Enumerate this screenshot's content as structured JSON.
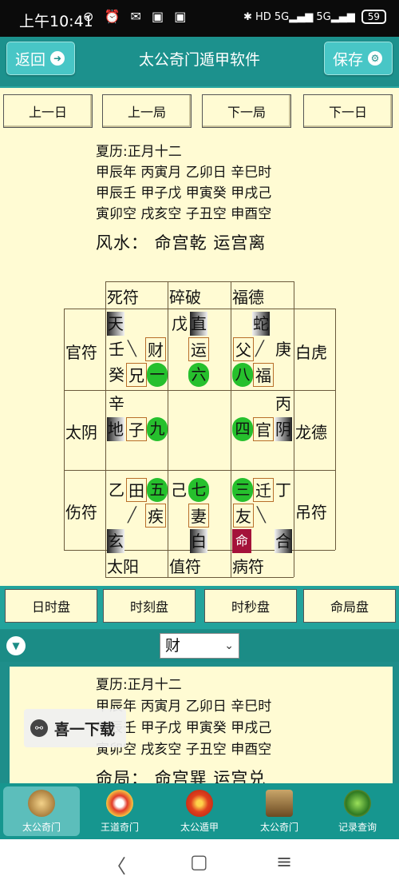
{
  "status": {
    "time": "上午10:41",
    "left_icons": "⊘ ⏰ ✉ ▣ ▣",
    "right_icons": "✱ HD 5G▂▄▆ 5G▂▄▆",
    "battery": "59"
  },
  "header": {
    "back": "返回",
    "title": "太公奇门遁甲软件",
    "save": "保存"
  },
  "nav": {
    "prev_day": "上一日",
    "prev_ju": "上一局",
    "next_ju": "下一局",
    "next_day": "下一日"
  },
  "info": {
    "line1": "夏历:正月十二",
    "line2": "甲辰年 丙寅月 乙卯日 辛巳时",
    "line3": "甲辰壬 甲子戊 甲寅癸 甲戌己",
    "line4": "寅卯空 戌亥空 子丑空 申酉空",
    "fengshui": "风水： 命宫乾 运宫离"
  },
  "chart": {
    "top": [
      "死符",
      "碎破",
      "福德"
    ],
    "bottom": [
      "太阳",
      "值符",
      "病符"
    ],
    "left": [
      "官符",
      "太阴",
      "伤符"
    ],
    "right": [
      "白虎",
      "龙德",
      "吊符"
    ],
    "c_nw": {
      "a": "天",
      "b": "壬",
      "c": "癸",
      "d": "兄",
      "e": "财",
      "num": "一"
    },
    "c_n": {
      "a": "戊",
      "b": "直",
      "c": "运",
      "num": "六"
    },
    "c_ne": {
      "a": "蛇",
      "b": "父",
      "c": "庚",
      "d": "福",
      "num": "八"
    },
    "c_w": {
      "a": "辛",
      "b": "地",
      "c": "子",
      "num": "九"
    },
    "c_e": {
      "a": "丙",
      "b": "官",
      "c": "阴",
      "num": "四"
    },
    "c_sw": {
      "a": "乙",
      "b": "田",
      "c": "疾",
      "d": "玄",
      "num": "五"
    },
    "c_s": {
      "a": "己",
      "b": "妻",
      "c": "白",
      "num": "七"
    },
    "c_se": {
      "a": "迁",
      "b": "丁",
      "c": "友",
      "d": "命",
      "e": "合",
      "num": "三"
    }
  },
  "tabs": [
    "日时盘",
    "时刻盘",
    "时秒盘",
    "命局盘"
  ],
  "select": {
    "value": "财"
  },
  "info2": {
    "line1": "夏历:正月十二",
    "line2": "甲辰年 丙寅月 乙卯日 辛巳时",
    "line3": "甲辰壬 甲子戊 甲寅癸 甲戌己",
    "line4": "寅卯空 戌亥空 子丑空 申酉空",
    "ming": "命局： 命宫巽 运宫兑"
  },
  "ad": {
    "text": "喜一下载"
  },
  "bottomnav": [
    "太公奇门",
    "王道奇门",
    "太公遁甲",
    "太公奇门",
    "记录查询"
  ]
}
